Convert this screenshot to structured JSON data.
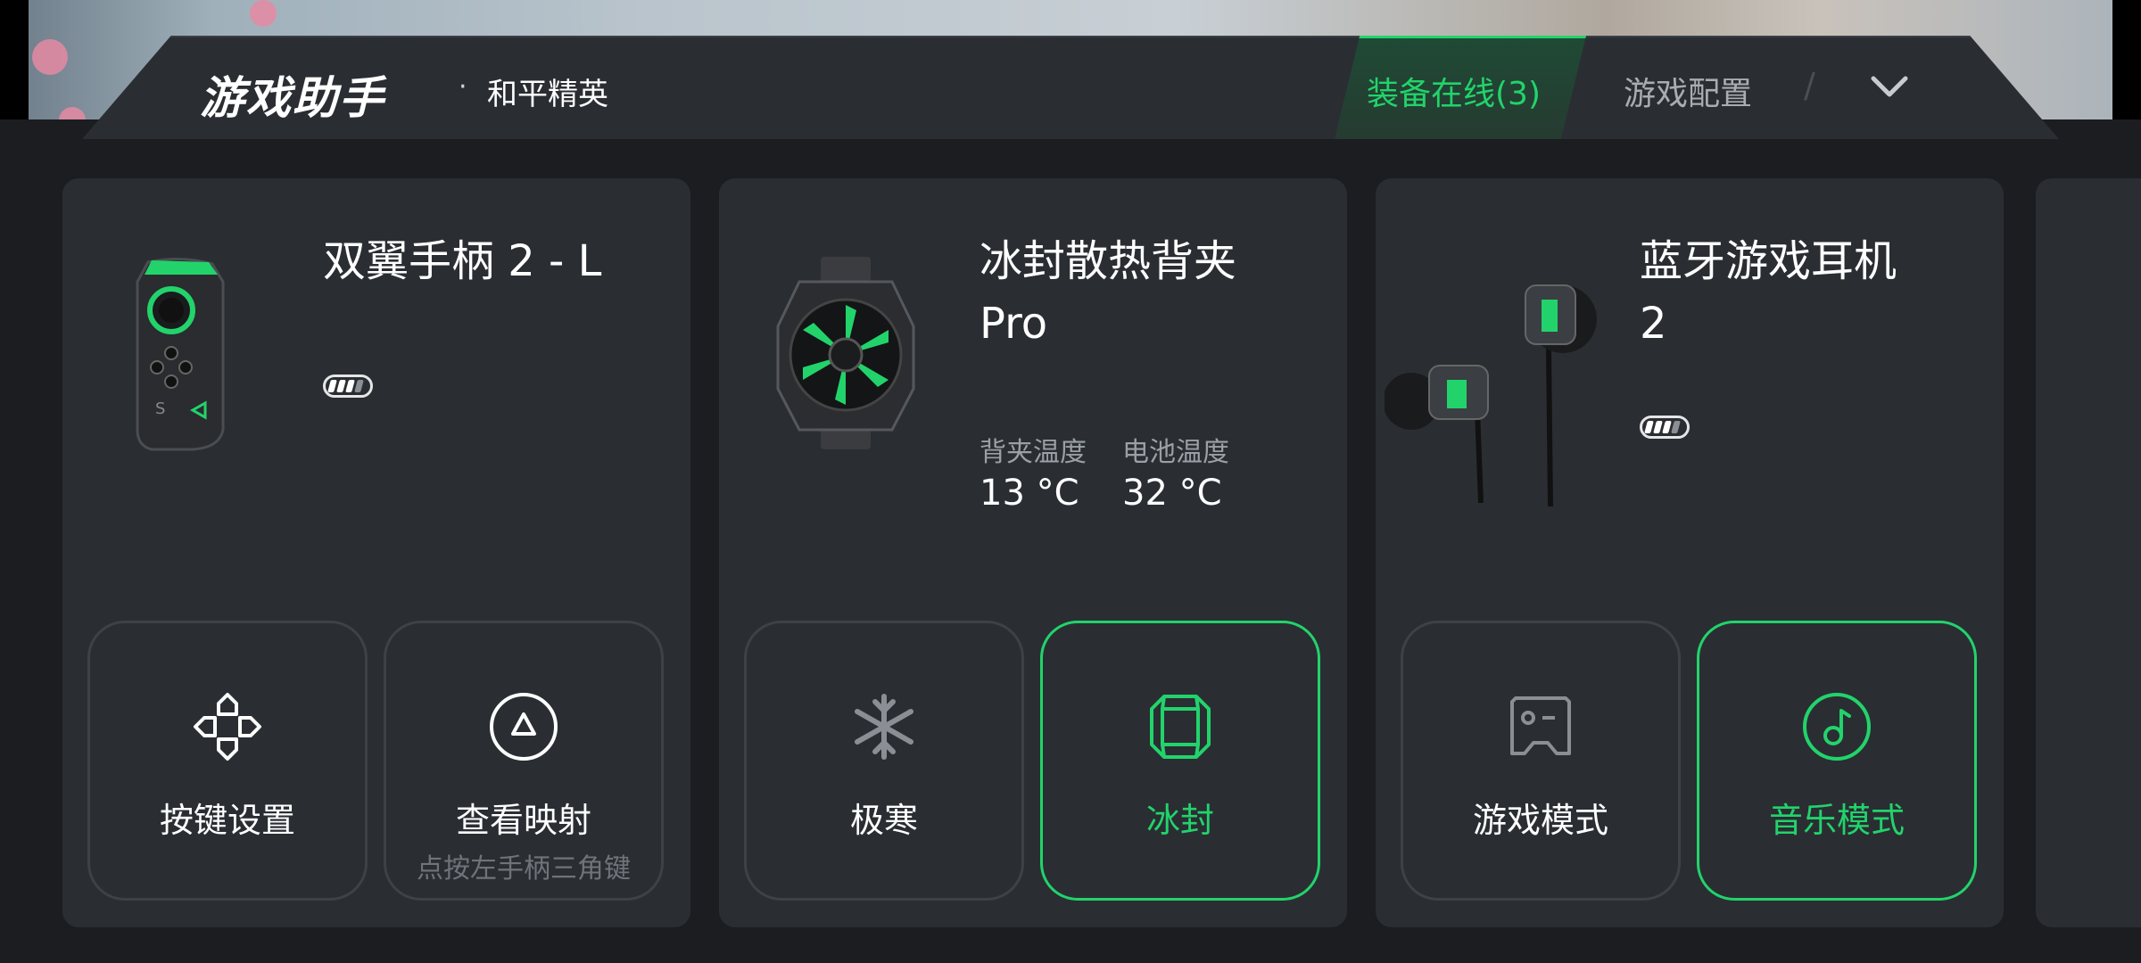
{
  "header": {
    "app_title": "游戏助手",
    "separator": "·",
    "game_name": "和平精英",
    "tab_devices": "装备在线(3)",
    "tab_config": "游戏配置",
    "tab_divider": "/",
    "expand_icon": "chevron-down-icon"
  },
  "colors": {
    "accent": "#22d36b",
    "card": "#2a2e33",
    "background": "#1b1d20"
  },
  "cards": [
    {
      "title": "双翼手柄 2 - L",
      "battery_level": 0.75,
      "buttons": [
        {
          "label": "按键设置",
          "icon": "dpad-icon",
          "active": false
        },
        {
          "label": "查看映射",
          "sublabel": "点按左手柄三角键",
          "icon": "triangle-circle-icon",
          "active": false
        }
      ]
    },
    {
      "title_line1": "冰封散热背夹",
      "title_line2": "Pro",
      "temps": [
        {
          "label": "背夹温度",
          "value": "13 °C"
        },
        {
          "label": "电池温度",
          "value": "32 °C"
        }
      ],
      "buttons": [
        {
          "label": "极寒",
          "icon": "snowflake-icon",
          "active": false
        },
        {
          "label": "冰封",
          "icon": "ice-cube-icon",
          "active": true
        }
      ]
    },
    {
      "title_line1": "蓝牙游戏耳机",
      "title_line2": "2",
      "battery_level": 0.75,
      "buttons": [
        {
          "label": "游戏模式",
          "icon": "game-mode-icon",
          "active": false
        },
        {
          "label": "音乐模式",
          "icon": "music-note-icon",
          "active": true
        }
      ]
    }
  ]
}
